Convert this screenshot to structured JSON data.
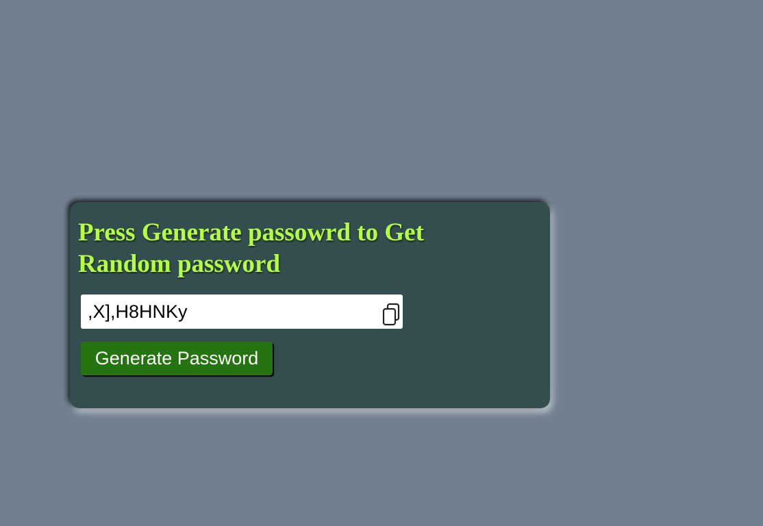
{
  "card": {
    "headline": "Press Generate passowrd to Get Random password"
  },
  "password": {
    "value": ",X],H8HNKy"
  },
  "copy_icon": "copy-icon",
  "generate_button": {
    "label": "Generate Password"
  },
  "colors": {
    "page_background": "#718090",
    "card_background": "#344e4f",
    "headline": "#b4fe44",
    "button_background": "#267311",
    "button_text": "#ffffff"
  }
}
